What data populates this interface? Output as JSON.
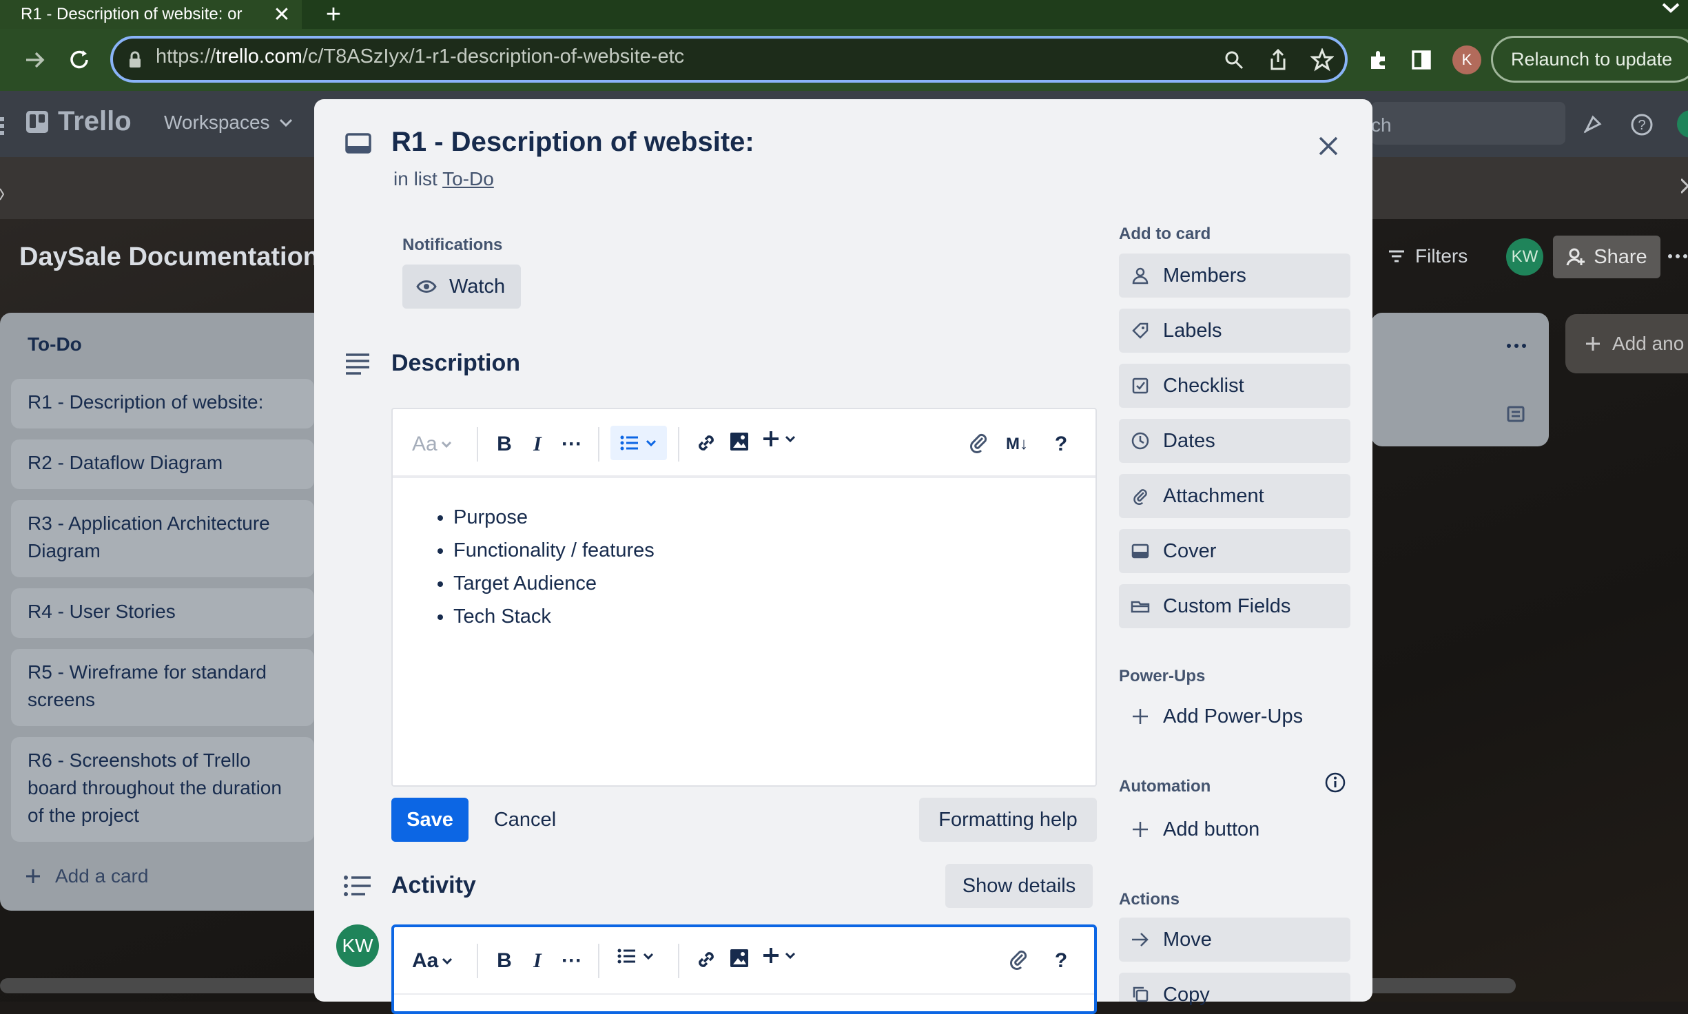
{
  "browser": {
    "tab_title": "R1 - Description of website: or",
    "close_tab": "✕",
    "new_tab": "+",
    "url_scheme": "https://",
    "url_domain": "trello.com",
    "url_path": "/c/T8ASzIyx/1-r1-description-of-website-etc",
    "profile_initial": "K",
    "relaunch_label": "Relaunch to update"
  },
  "trello": {
    "logo": "Trello",
    "workspaces": "Workspaces",
    "search_placeholder": "ch"
  },
  "board": {
    "title": "DaySale Documentation",
    "filters": "Filters",
    "member_initials": "KW",
    "share": "Share",
    "add_list": "Add ano"
  },
  "list": {
    "title": "To-Do",
    "cards": [
      "R1 - Description of website:",
      "R2 - Dataflow Diagram",
      "R3 - Application Architecture Diagram",
      "R4 - User Stories",
      "R5 - Wireframe for standard screens",
      "R6 - Screenshots of Trello board throughout the duration of the project"
    ],
    "add_card": "Add a card"
  },
  "modal": {
    "title": "R1 - Description of website:",
    "in_list_prefix": "in list",
    "list_link": "To-Do",
    "notifications_label": "Notifications",
    "watch": "Watch",
    "description_heading": "Description",
    "toolbar": {
      "text_style": "Aa",
      "bold": "B",
      "italic": "I",
      "more": "···",
      "markdown": "M↓",
      "help": "?"
    },
    "description_items": [
      "Purpose",
      "Functionality / features",
      "Target Audience",
      "Tech Stack"
    ],
    "save": "Save",
    "cancel": "Cancel",
    "formatting_help": "Formatting help",
    "activity_heading": "Activity",
    "show_details": "Show details",
    "avatar_initials": "KW"
  },
  "sidebar": {
    "add_to_card": "Add to card",
    "buttons": [
      "Members",
      "Labels",
      "Checklist",
      "Dates",
      "Attachment",
      "Cover",
      "Custom Fields"
    ],
    "power_ups_label": "Power-Ups",
    "add_power_ups": "Add Power-Ups",
    "automation_label": "Automation",
    "add_button": "Add button",
    "actions_label": "Actions",
    "move": "Move",
    "copy": "Copy"
  },
  "colors": {
    "primary": "#0c66e4",
    "avatar": "#1f845a",
    "url_focus": "#8ab4f8"
  }
}
